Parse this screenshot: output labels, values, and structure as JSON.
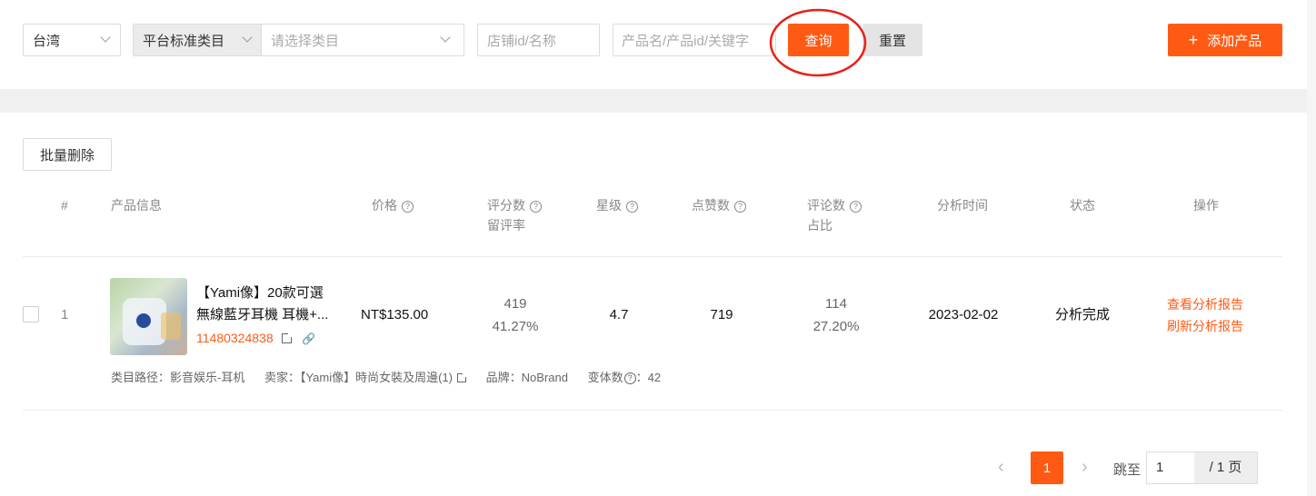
{
  "filters": {
    "region": "台湾",
    "category_type": "平台标准类目",
    "category_placeholder": "请选择类目",
    "shop_placeholder": "店铺id/名称",
    "product_placeholder": "产品名/产品id/关键字",
    "query_label": "查询",
    "reset_label": "重置",
    "add_label": "添加产品",
    "add_icon": "+"
  },
  "toolbar": {
    "batch_delete": "批量删除"
  },
  "columns": {
    "index": "#",
    "product_info": "产品信息",
    "price": "价格",
    "rating_count": "评分数",
    "rating_rate": "留评率",
    "stars": "星级",
    "likes": "点赞数",
    "review_count": "评论数",
    "review_ratio": "占比",
    "analysis_time": "分析时间",
    "status": "状态",
    "actions": "操作",
    "help_icon": "?"
  },
  "rows": [
    {
      "index": "1",
      "title_line1": "【Yami像】20款可選",
      "title_line2": "無線藍牙耳機 耳機+...",
      "product_id": "11480324838",
      "price": "NT$135.00",
      "rating_count": "419",
      "rating_rate": "41.27%",
      "stars": "4.7",
      "likes": "719",
      "review_count": "114",
      "review_ratio": "27.20%",
      "analysis_time": "2023-02-02",
      "status": "分析完成",
      "action_view": "查看分析报告",
      "action_refresh": "刷新分析报告",
      "category_path": "类目路径：影音娱乐-耳机",
      "seller": "卖家：【Yami像】時尚女裝及周邊(1)",
      "brand": "品牌：NoBrand",
      "variant_label": "变体数",
      "variant_value": "：42"
    }
  ],
  "pagination": {
    "prev": "‹",
    "current": "1",
    "next": "›",
    "jump_label": "跳至",
    "jump_value": "1",
    "total": "/ 1 页"
  },
  "colors": {
    "accent": "#ff5a14",
    "annotation": "#e8201a"
  }
}
